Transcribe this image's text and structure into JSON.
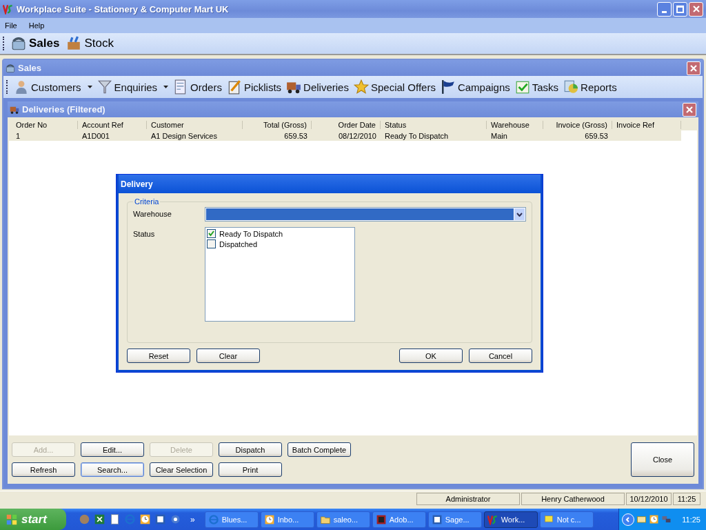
{
  "window": {
    "title": "Workplace Suite - Stationery & Computer Mart UK"
  },
  "menu": [
    "File",
    "Help"
  ],
  "modules": [
    {
      "label": "Sales",
      "selected": true
    },
    {
      "label": "Stock",
      "selected": false
    }
  ],
  "sales_panel": {
    "title": "Sales",
    "toolbar": [
      {
        "label": "Customers",
        "dropdown": true
      },
      {
        "label": "Enquiries",
        "dropdown": true
      },
      {
        "label": "Orders",
        "dropdown": false
      },
      {
        "label": "Picklists",
        "dropdown": false
      },
      {
        "label": "Deliveries",
        "dropdown": false
      },
      {
        "label": "Special Offers",
        "dropdown": false
      },
      {
        "label": "Campaigns",
        "dropdown": false
      },
      {
        "label": "Tasks",
        "dropdown": false
      },
      {
        "label": "Reports",
        "dropdown": false
      }
    ]
  },
  "deliveries_panel": {
    "title": "Deliveries (Filtered)",
    "table": {
      "columns": [
        "Order No",
        "Account Ref",
        "Customer",
        "Total (Gross)",
        "Order Date",
        "Status",
        "Warehouse",
        "Invoice (Gross)",
        "Invoice Ref"
      ],
      "rows": [
        {
          "selected": true,
          "cells": [
            "1",
            "A1D001",
            "A1 Design Services",
            "659.53",
            "08/12/2010",
            "Ready To Dispatch",
            "Main",
            "659.53",
            null
          ]
        }
      ]
    },
    "buttons": [
      {
        "label": "Add...",
        "disabled": true,
        "focused": false
      },
      {
        "label": "Edit...",
        "disabled": false,
        "focused": false
      },
      {
        "label": "Delete",
        "disabled": true,
        "focused": false
      },
      {
        "label": "Dispatch",
        "disabled": false,
        "focused": false
      },
      {
        "label": "Batch Complete",
        "disabled": false,
        "focused": false
      },
      {
        "label": "Refresh",
        "disabled": false,
        "focused": false
      },
      {
        "label": "Search...",
        "disabled": false,
        "focused": true
      },
      {
        "label": "Clear Selection",
        "disabled": false,
        "focused": false
      },
      {
        "label": "Print",
        "disabled": false,
        "focused": false
      }
    ],
    "close_button": "Close"
  },
  "dialog": {
    "title": "Delivery",
    "group": "Criteria",
    "warehouse_label": "Warehouse",
    "status_label": "Status",
    "status_options": [
      {
        "label": "Ready To Dispatch",
        "checked": true
      },
      {
        "label": "Dispatched",
        "checked": false
      }
    ],
    "left_buttons": [
      "Reset",
      "Clear"
    ],
    "right_buttons": [
      "OK",
      "Cancel"
    ]
  },
  "status_bar": [
    "Administrator",
    "Henry Catherwood",
    "10/12/2010",
    "11:25"
  ],
  "taskbar": {
    "start": "start",
    "chevron": "»",
    "tasks": [
      {
        "label": "Blues...",
        "selected": false
      },
      {
        "label": "Inbo...",
        "selected": false
      },
      {
        "label": "saleo...",
        "selected": false
      },
      {
        "label": "Adob...",
        "selected": false
      },
      {
        "label": "Sage...",
        "selected": false
      },
      {
        "label": "Work...",
        "selected": true
      },
      {
        "label": "Not c...",
        "selected": false
      }
    ],
    "clock": "11:25"
  }
}
